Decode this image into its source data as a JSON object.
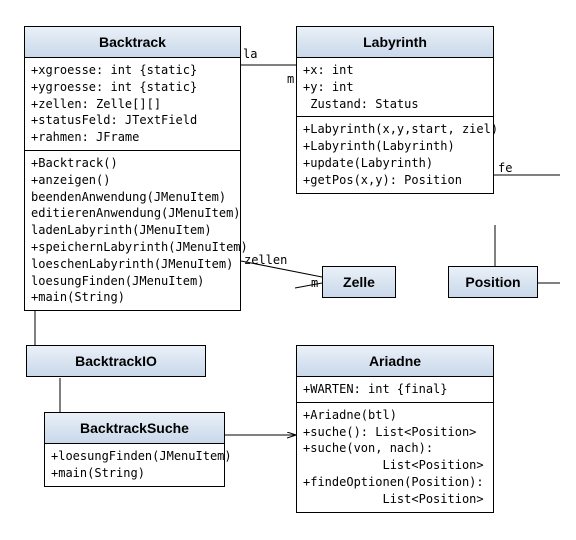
{
  "classes": {
    "backtrack": {
      "name": "Backtrack",
      "attrs": "+xgroesse: int {static}\n+ygroesse: int {static}\n+zellen: Zelle[][]\n+statusFeld: JTextField\n+rahmen: JFrame",
      "ops": "+Backtrack()\n+anzeigen()\nbeendenAnwendung(JMenuItem)\neditierenAnwendung(JMenuItem)\nladenLabyrinth(JMenuItem)\n+speichernLabyrinth(JMenuItem)\nloeschenLabyrinth(JMenuItem)\nloesungFinden(JMenuItem)\n+main(String)"
    },
    "labyrinth": {
      "name": "Labyrinth",
      "attrs": "+x: int\n+y: int\n Zustand: Status",
      "ops": "+Labyrinth(x,y,start, ziel)\n+Labyrinth(Labyrinth)\n+update(Labyrinth)\n+getPos(x,y): Position"
    },
    "zelle": {
      "name": "Zelle"
    },
    "position": {
      "name": "Position"
    },
    "backtrackio": {
      "name": "BacktrackIO"
    },
    "backtracksuche": {
      "name": "BacktrackSuche",
      "ops": "+loesungFinden(JMenuItem)\n+main(String)"
    },
    "ariadne": {
      "name": "Ariadne",
      "attrs": "+WARTEN: int {final}",
      "ops": "+Ariadne(btl)\n+suche(): List<Position>\n+suche(von, nach):\n           List<Position>\n+findeOptionen(Position):\n           List<Position>"
    }
  },
  "labels": {
    "la_top": "la",
    "zellen": "zellen",
    "m_left": "m",
    "m_right": "m",
    "fe": "fe"
  }
}
